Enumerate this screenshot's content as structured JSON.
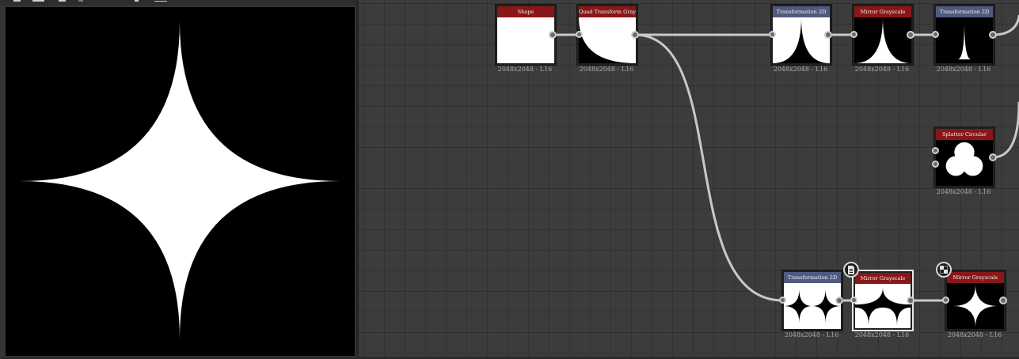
{
  "view": {
    "toolbar_icons": [
      "toolbar-icon",
      "toolbar-icon",
      "toolbar-icon",
      "toolbar-icon",
      "toolbar-icon",
      "toolbar-icon"
    ],
    "preview_shape": "four-point-star"
  },
  "graph": {
    "nodes": {
      "shape": {
        "title": "Shape",
        "caption": "2048x2048 - L16",
        "header_color": "#8a1717"
      },
      "quad_transform": {
        "title": "Quad Transform Gray...",
        "caption": "2048x2048 - L16",
        "header_color": "#8a1717"
      },
      "transformation_2d_a": {
        "title": "Transformation 2D",
        "caption": "2048x2048 - L16",
        "header_color": "#505a80"
      },
      "mirror_grayscale_a": {
        "title": "Mirror Grayscale",
        "caption": "2048x2048 - L16",
        "header_color": "#8a1717"
      },
      "transformation_2d_b": {
        "title": "Transformation 2D",
        "caption": "2048x2048 - L16",
        "header_color": "#505a80"
      },
      "splatter_circular": {
        "title": "Splatter Circular",
        "caption": "2048x2048 - L16",
        "header_color": "#8a1717"
      },
      "transformation_2d_c": {
        "title": "Transformation 2D",
        "caption": "2048x2048 - L16",
        "header_color": "#505a80"
      },
      "mirror_grayscale_b": {
        "title": "Mirror Grayscale",
        "caption": "2048x2048 - L16",
        "header_color": "#8a1717"
      },
      "mirror_grayscale_c": {
        "title": "Mirror Grayscale",
        "caption": "2048x2048 - L16",
        "header_color": "#8a1717"
      }
    },
    "badges": [
      "document-icon",
      "checker-icon"
    ]
  }
}
